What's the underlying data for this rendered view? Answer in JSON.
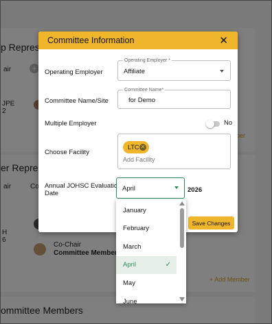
{
  "background": {
    "section1_title": "p Representa",
    "section1_col_label": "air",
    "section1_member_code": "JPE\n2",
    "section2_title": "er Represe",
    "section2_col1": "air",
    "section2_col2": "Co",
    "section2_member_code": "H\n6",
    "cochair_role": "Co-Chair",
    "cochair_name": "Committee Member or",
    "add_member_link": "+ Add Member",
    "partial_member_link": "ber",
    "section3_title": "ommittee Members"
  },
  "modal": {
    "title": "Committee Information",
    "operating_employer": {
      "label": "Operating Employer",
      "legend": "Operating Employer *",
      "value": "Affiliate"
    },
    "committee_name": {
      "label": "Committee Name/Site",
      "legend": "Committee Name*",
      "value": "for Demo"
    },
    "multiple_employer": {
      "label": "Multiple Employer",
      "toggle_text": "No"
    },
    "facility": {
      "label": "Choose Facility",
      "chip": "LTC",
      "placeholder": "Add Facility"
    },
    "evaluation_date": {
      "label_line1": "Annual JOHSC Evaluation",
      "label_line2": "Date",
      "month": "April",
      "year": "2026"
    },
    "save_button": "Save Changes"
  },
  "month_dropdown": {
    "options": [
      "January",
      "February",
      "March",
      "April",
      "May",
      "June"
    ],
    "selected": "April"
  },
  "colors": {
    "accent": "#f0b62b",
    "selected_text": "#2e8b57",
    "selected_bg": "#e6eee8"
  }
}
